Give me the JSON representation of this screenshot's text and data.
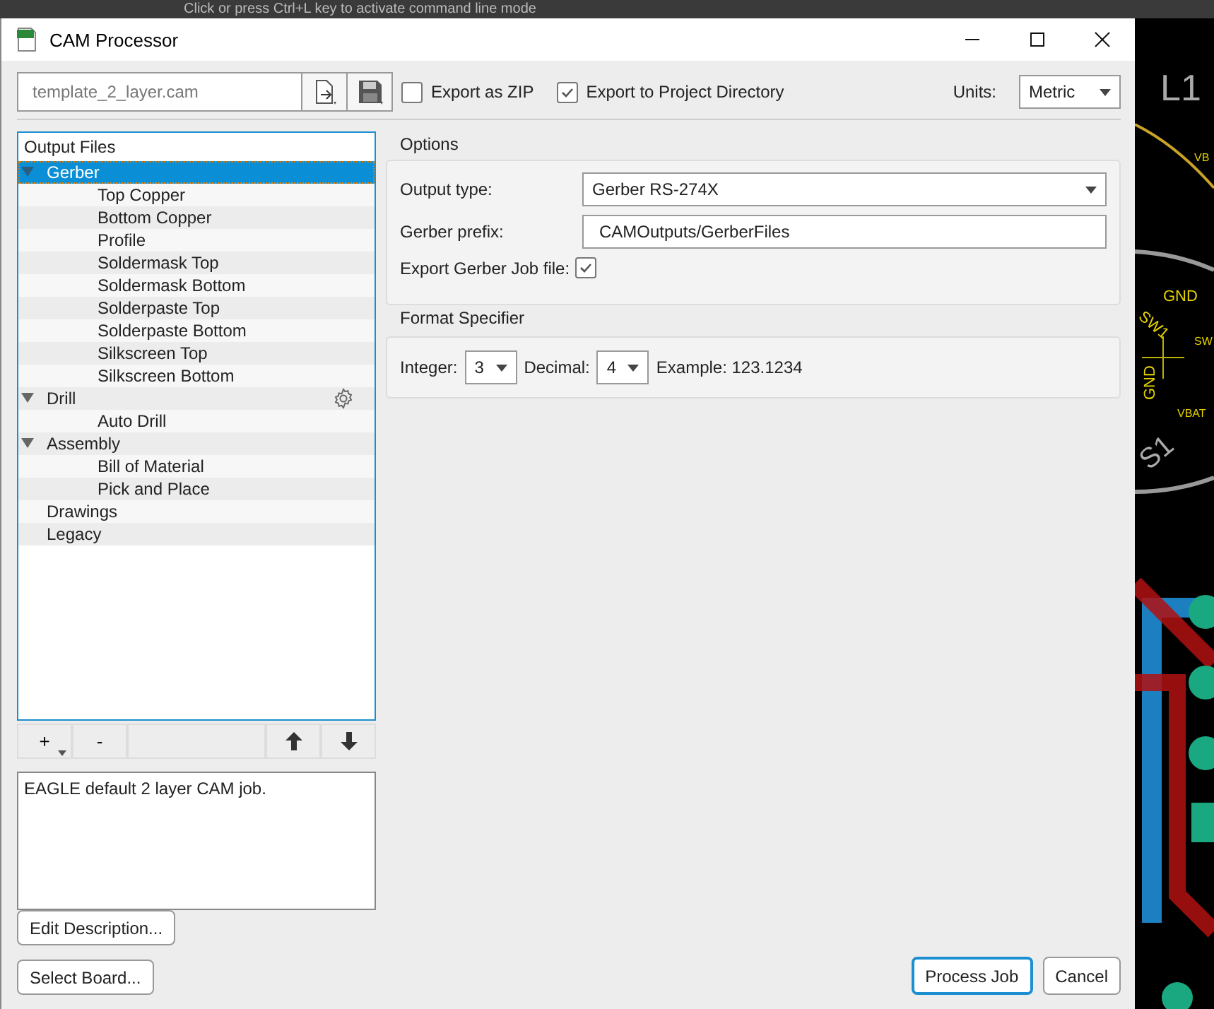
{
  "background": {
    "command_hint": "Click or press Ctrl+L key to activate command line mode",
    "pcb_labels": [
      "L1",
      "VB",
      "GND",
      "SW1",
      "GND",
      "SW",
      "VBAT",
      "S1"
    ]
  },
  "window": {
    "title": "CAM Processor"
  },
  "toolbar": {
    "job_file": "template_2_layer.cam",
    "export_zip": {
      "label": "Export as ZIP",
      "checked": false
    },
    "export_project": {
      "label": "Export to Project Directory",
      "checked": true
    },
    "units_label": "Units:",
    "units": "Metric"
  },
  "output_files": {
    "header": "Output Files",
    "items": [
      {
        "label": "Gerber",
        "expanded": true,
        "selected": true,
        "children": [
          {
            "label": "Top Copper",
            "selected": false
          },
          {
            "label": "Bottom Copper",
            "selected": false
          },
          {
            "label": "Profile",
            "selected": false
          },
          {
            "label": "Soldermask Top",
            "selected": false
          },
          {
            "label": "Soldermask Bottom",
            "selected": false
          },
          {
            "label": "Solderpaste Top",
            "selected": false
          },
          {
            "label": "Solderpaste Bottom",
            "selected": false
          },
          {
            "label": "Silkscreen Top",
            "selected": false
          },
          {
            "label": "Silkscreen Bottom",
            "selected": false
          }
        ]
      },
      {
        "label": "Drill",
        "expanded": true,
        "selected": false,
        "hovered": true,
        "children": [
          {
            "label": "Auto Drill",
            "selected": false
          }
        ]
      },
      {
        "label": "Assembly",
        "expanded": true,
        "selected": false,
        "children": [
          {
            "label": "Bill of Material",
            "selected": false
          },
          {
            "label": "Pick and Place",
            "selected": false
          }
        ]
      },
      {
        "label": "Drawings",
        "selected": false
      },
      {
        "label": "Legacy",
        "selected": false
      }
    ]
  },
  "list_buttons": [
    "+",
    "-"
  ],
  "description": "EAGLE default 2 layer CAM job.",
  "edit_description": "Edit Description...",
  "select_board": "Select Board...",
  "options": {
    "title": "Options",
    "output_type_label": "Output type:",
    "output_type": "Gerber RS-274X",
    "prefix_label": "Gerber prefix:",
    "prefix": "CAMOutputs/GerberFiles",
    "job_file_label": "Export Gerber Job file:",
    "job_file_checked": true
  },
  "format": {
    "title": "Format Specifier",
    "integer_label": "Integer:",
    "integer": "3",
    "decimal_label": "Decimal:",
    "decimal": "4",
    "example": "Example: 123.1234"
  },
  "buttons": [
    {
      "label": "Process Job",
      "default": true
    },
    {
      "label": "Cancel",
      "default": false
    }
  ]
}
